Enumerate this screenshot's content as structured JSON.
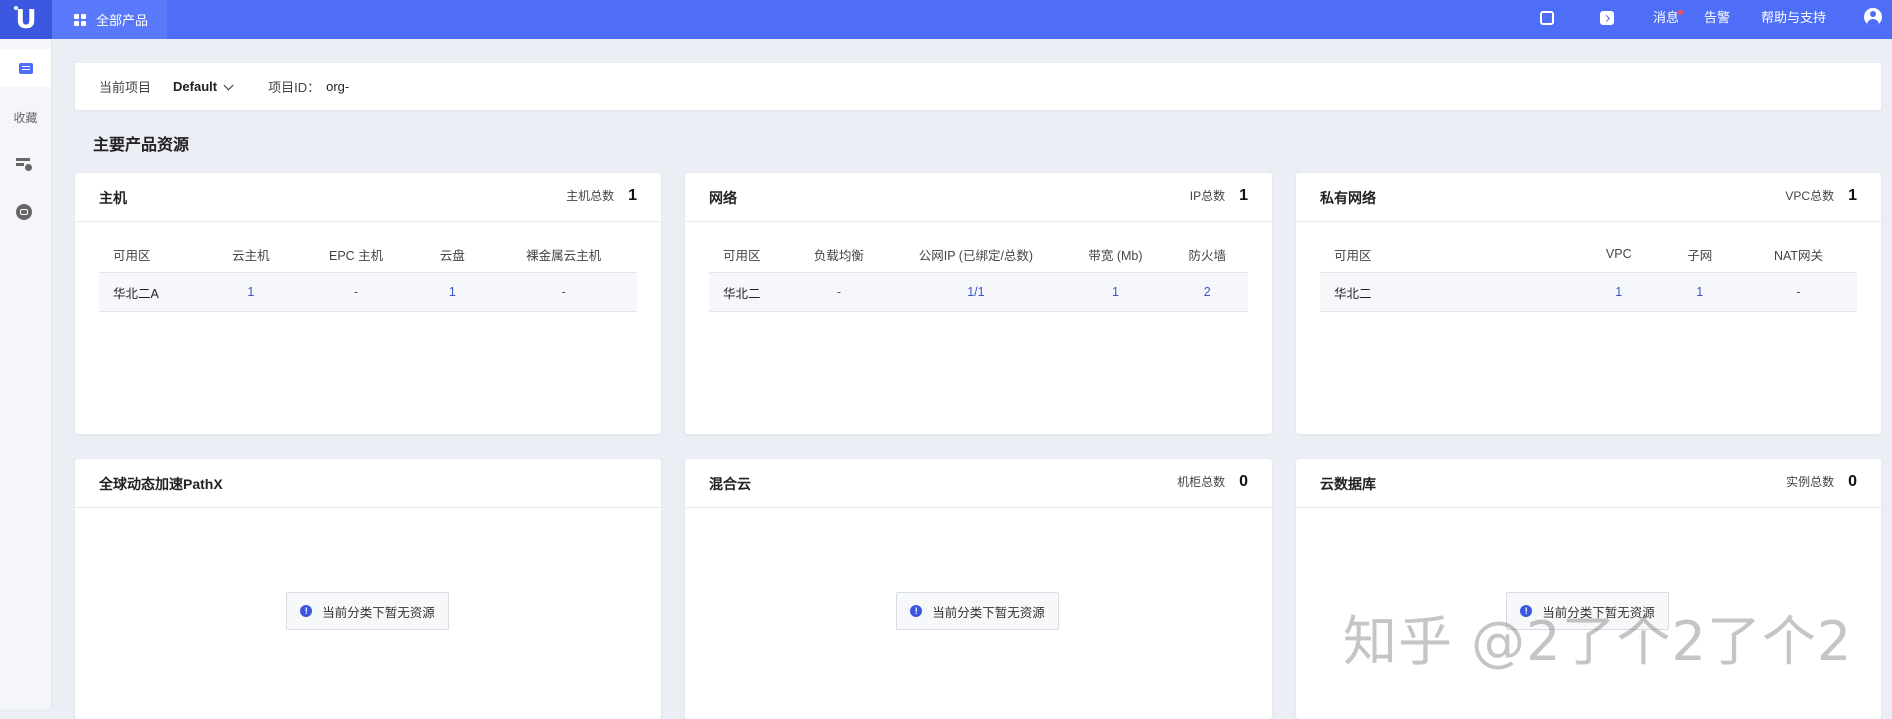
{
  "topbar": {
    "logo": "U",
    "all_products": "全部产品",
    "messages": "消息",
    "alerts": "告警",
    "help": "帮助与支持"
  },
  "sidebar": {
    "favorites": "收藏"
  },
  "project": {
    "current_label": "当前项目",
    "current_value": "Default",
    "id_label": "项目ID：",
    "id_value": "org-"
  },
  "section_title": "主要产品资源",
  "cards": {
    "host": {
      "title": "主机",
      "stat_label": "主机总数",
      "stat_value": "1",
      "columns": [
        "可用区",
        "云主机",
        "EPC 主机",
        "云盘",
        "裸金属云主机"
      ],
      "rows": [
        [
          "华北二A",
          "1",
          "-",
          "1",
          "-"
        ]
      ]
    },
    "network": {
      "title": "网络",
      "stat_label": "IP总数",
      "stat_value": "1",
      "columns": [
        "可用区",
        "负载均衡",
        "公网IP (已绑定/总数)",
        "带宽 (Mb)",
        "防火墙"
      ],
      "rows": [
        [
          "华北二",
          "-",
          "1/1",
          "1",
          "2"
        ]
      ]
    },
    "vpc": {
      "title": "私有网络",
      "stat_label": "VPC总数",
      "stat_value": "1",
      "columns": [
        "可用区",
        "VPC",
        "子网",
        "NAT网关"
      ],
      "rows": [
        [
          "华北二",
          "1",
          "1",
          "-"
        ]
      ]
    },
    "pathx": {
      "title": "全球动态加速PathX",
      "empty_text": "当前分类下暂无资源"
    },
    "hybrid": {
      "title": "混合云",
      "stat_label": "机柜总数",
      "stat_value": "0",
      "empty_text": "当前分类下暂无资源"
    },
    "database": {
      "title": "云数据库",
      "stat_label": "实例总数",
      "stat_value": "0",
      "empty_text": "当前分类下暂无资源"
    }
  },
  "watermark": "知乎 @2了个2了个2",
  "colors": {
    "topbar": "#4f6ef7",
    "accent": "#3b57e0",
    "background": "#eceef5"
  }
}
